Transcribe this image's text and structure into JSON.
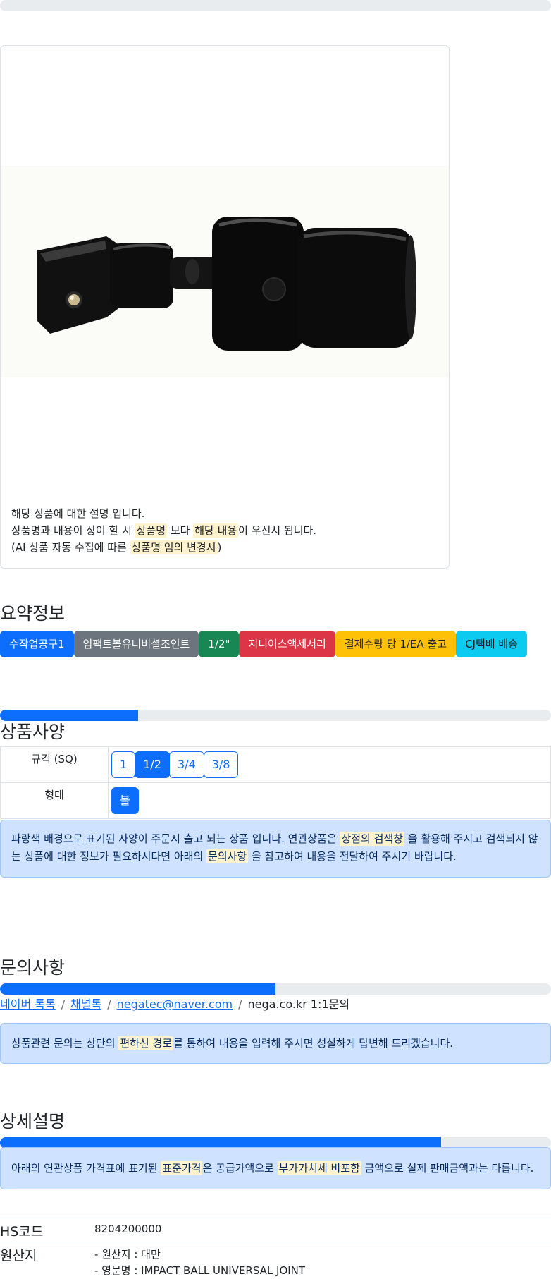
{
  "description": {
    "line1": "해당 상품에 대한 설명 입니다.",
    "line2_a": "상품명과 내용이 상이 할 시 ",
    "line2_hl1": "상품명",
    "line2_b": " 보다 ",
    "line2_hl2": "해당 내용",
    "line2_c": "이 우선시 됩니다.",
    "line3_a": "(AI 상품 자동 수집에 따른 ",
    "line3_hl": "상품명 임의 변경시",
    "line3_b": ")"
  },
  "summary": {
    "title": "요약정보",
    "badges": [
      "수작업공구1",
      "임팩트볼유니버셜조인트",
      "1/2\"",
      "지니어스액세서리",
      "결제수량 당 1/EA 출고",
      "CJ택배 배송"
    ],
    "badge_colors": [
      "#0d6efd",
      "#6c757d",
      "#198754",
      "#dc3545",
      "#ffc107",
      "#0dcaf0"
    ]
  },
  "spec": {
    "title": "상품사양",
    "progress": 0.25,
    "rows": [
      {
        "label": "규격 (SQ)",
        "options": [
          "1",
          "1/2",
          "3/4",
          "3/8"
        ],
        "selected": "1/2"
      },
      {
        "label": "형태",
        "options": [
          "볼"
        ],
        "selected": "볼"
      }
    ],
    "notice_a": "파랑색 배경으로 표기된 사양이 주문시 출고 되는 상품 입니다. 연관상품은 ",
    "notice_hl1": "상점의 검색창",
    "notice_b": " 을 활용해 주시고 검색되지 않는 상품에 대한 정보가 필요하시다면 아래의 ",
    "notice_hl2": "문의사항",
    "notice_c": " 을 참고하여 내용을 전달하여 주시기 바랍니다."
  },
  "inquiry": {
    "title": "문의사항",
    "progress": 0.5,
    "links": [
      "네이버 톡톡",
      "채널톡",
      "negatec@naver.com"
    ],
    "plain": "nega.co.kr 1:1문의",
    "notice_a": "상품관련 문의는 상단의 ",
    "notice_hl": "편하신 경로",
    "notice_b": "를 통하여 내용을 입력해 주시면 성실하게 답변해 드리겠습니다."
  },
  "detail": {
    "title": "상세설명",
    "progress": 0.8,
    "notice_a": "아래의 연관상품 가격표에 표기된 ",
    "notice_hl1": "표준가격",
    "notice_b": "은 공급가액으로 ",
    "notice_hl2": "부가가치세 비포함",
    "notice_c": " 금액으로 실제 판매금액과는 다릅니다.",
    "hs_label": "HS코드",
    "hs_value": "8204200000",
    "origin_label": "원산지",
    "origin_line1": "- 원산지 : 대만",
    "origin_line2": "- 영문명 : IMPACT BALL UNIVERSAL JOINT"
  }
}
